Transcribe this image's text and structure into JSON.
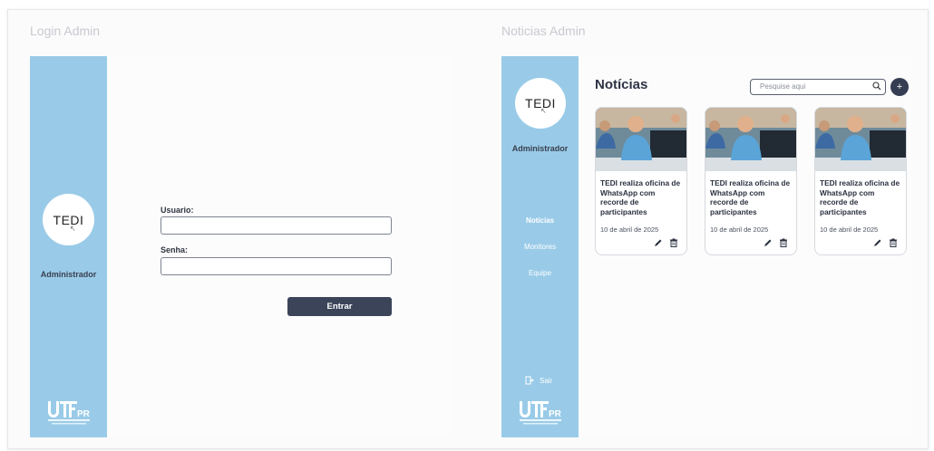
{
  "login": {
    "frame_title": "Login Admin",
    "avatar_text": "TEDI",
    "admin_label": "Administrador",
    "username_label": "Usuario:",
    "username_value": "",
    "password_label": "Senha:",
    "password_value": "",
    "submit_label": "Entrar",
    "logo_text": "UTFPR"
  },
  "news": {
    "frame_title": "Noticias Admin",
    "avatar_text": "TEDI",
    "admin_label": "Administrador",
    "nav": [
      {
        "label": "Notícias",
        "active": true
      },
      {
        "label": "Monitores",
        "active": false
      },
      {
        "label": "Equipe",
        "active": false
      }
    ],
    "logout_label": "Sair",
    "logo_text": "UTFPR",
    "heading": "Notícias",
    "search_placeholder": "Pesquise aqui",
    "add_label": "+",
    "cards": [
      {
        "title": "TEDI realiza oficina de WhatsApp com recorde de participantes",
        "date": "10 de abril de 2025"
      },
      {
        "title": "TEDI realiza oficina de WhatsApp com recorde de participantes",
        "date": "10 de abril de 2025"
      },
      {
        "title": "TEDI realiza oficina de WhatsApp com recorde de participantes",
        "date": "10 de abril de 2025"
      }
    ]
  },
  "colors": {
    "sidebar": "#99cbe8",
    "primary_button": "#3b4459",
    "add_button": "#353d52"
  }
}
